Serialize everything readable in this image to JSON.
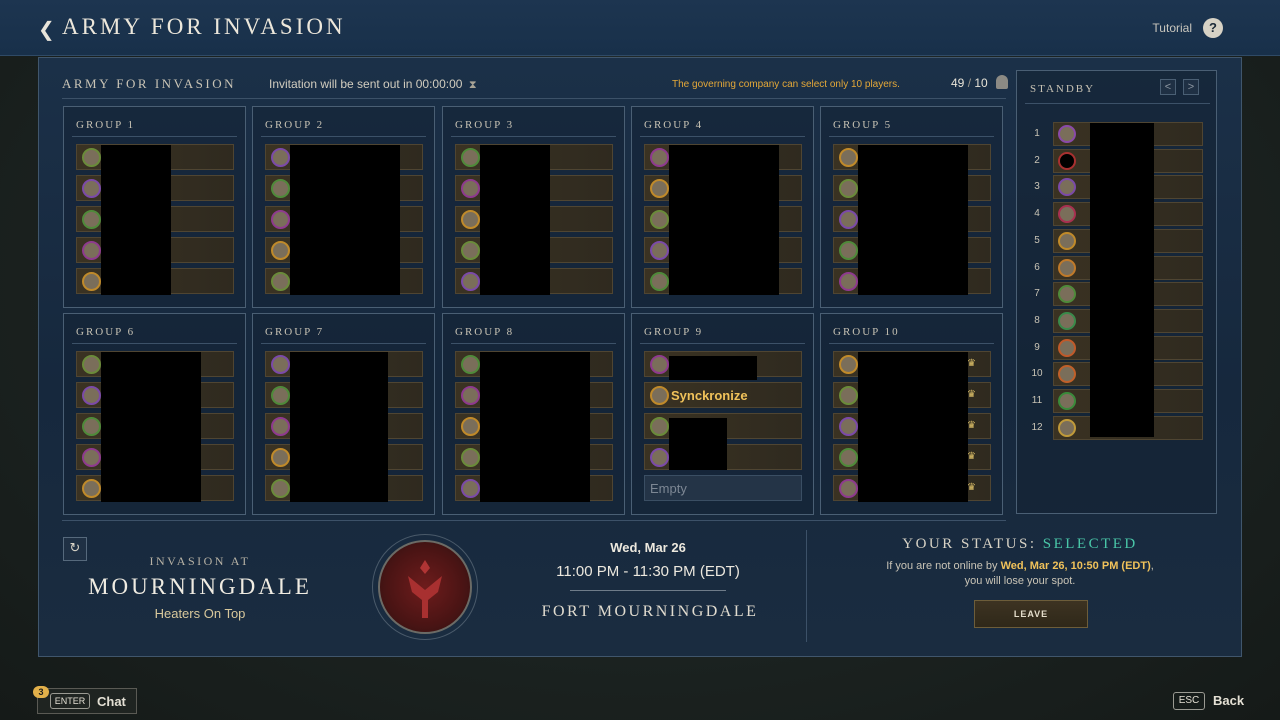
{
  "header": {
    "title": "ARMY FOR INVASION",
    "tutorial_label": "Tutorial",
    "help_label": "?"
  },
  "panel": {
    "title": "ARMY FOR INVASION",
    "invitation_text": "Invitation will be sent out in 00:00:00",
    "hourglass": "⧗",
    "notice": "The governing company can select only 10 players.",
    "count_selected": "49",
    "count_slash": " / ",
    "count_max": "10"
  },
  "groups": [
    {
      "title": "GROUP 1"
    },
    {
      "title": "GROUP 2"
    },
    {
      "title": "GROUP 3"
    },
    {
      "title": "GROUP 4"
    },
    {
      "title": "GROUP 5"
    },
    {
      "title": "GROUP 6"
    },
    {
      "title": "GROUP 7"
    },
    {
      "title": "GROUP 8"
    },
    {
      "title": "GROUP 9",
      "visible_name": "Synckronize",
      "empty_label": "Empty"
    },
    {
      "title": "GROUP 10",
      "crown_icon": "crown-icon"
    }
  ],
  "standby": {
    "title": "STANDBY",
    "prev_label": "<",
    "next_label": ">",
    "numbers": [
      "1",
      "2",
      "3",
      "4",
      "5",
      "6",
      "7",
      "8",
      "9",
      "10",
      "11",
      "12"
    ]
  },
  "invasion": {
    "label": "INVASION AT",
    "location": "MOURNINGDALE",
    "company": "Heaters On Top",
    "date": "Wed, Mar 26",
    "time": "11:00 PM - 11:30 PM  (EDT)",
    "fort": "FORT MOURNINGDALE",
    "refresh_icon": "refresh-icon"
  },
  "status": {
    "label": "YOUR STATUS: ",
    "value": "SELECTED",
    "note_before": "If you are not online by ",
    "note_time": "Wed, Mar 26, 10:50 PM  (EDT)",
    "note_after": ",",
    "note_line2": "you will lose your spot.",
    "leave_label": "LEAVE"
  },
  "footer": {
    "chat_badge": "3",
    "enter_key": "ENTER",
    "chat_label": "Chat",
    "esc_key": "ESC",
    "back_label": "Back"
  },
  "colors": {
    "accent_gold": "#f0c25a",
    "status_green": "#49c6a8",
    "notice_orange": "#e4a838"
  }
}
